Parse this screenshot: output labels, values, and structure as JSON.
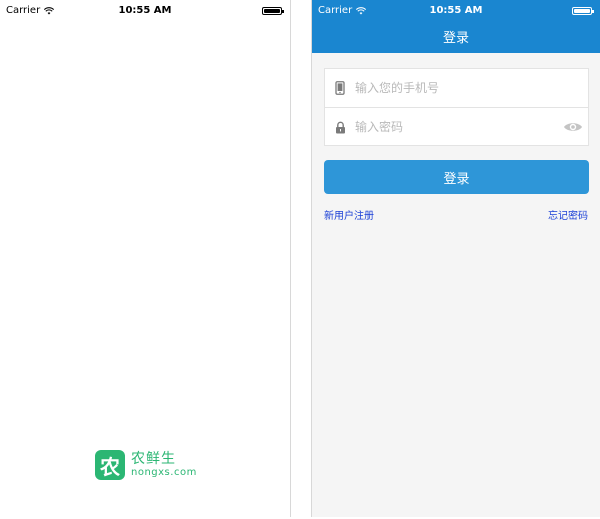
{
  "status_bar": {
    "carrier": "Carrier",
    "time": "10:55 AM",
    "wifi_icon": "wifi-icon",
    "battery_icon": "battery-icon"
  },
  "splash": {
    "brand_logo_glyph": "农",
    "brand_name": "农鲜生",
    "brand_domain": "nongxs.com",
    "brand_color": "#2bb673"
  },
  "login": {
    "nav_title": "登录",
    "nav_color": "#1a86d0",
    "phone_field": {
      "icon": "phone-icon",
      "placeholder": "输入您的手机号",
      "value": ""
    },
    "password_field": {
      "icon": "lock-icon",
      "placeholder": "输入密码",
      "value": "",
      "toggle_icon": "eye-icon"
    },
    "submit_label": "登录",
    "button_color": "#2e96d8",
    "register_link": "新用户注册",
    "forgot_link": "忘记密码",
    "link_color": "#1a3fd6"
  }
}
